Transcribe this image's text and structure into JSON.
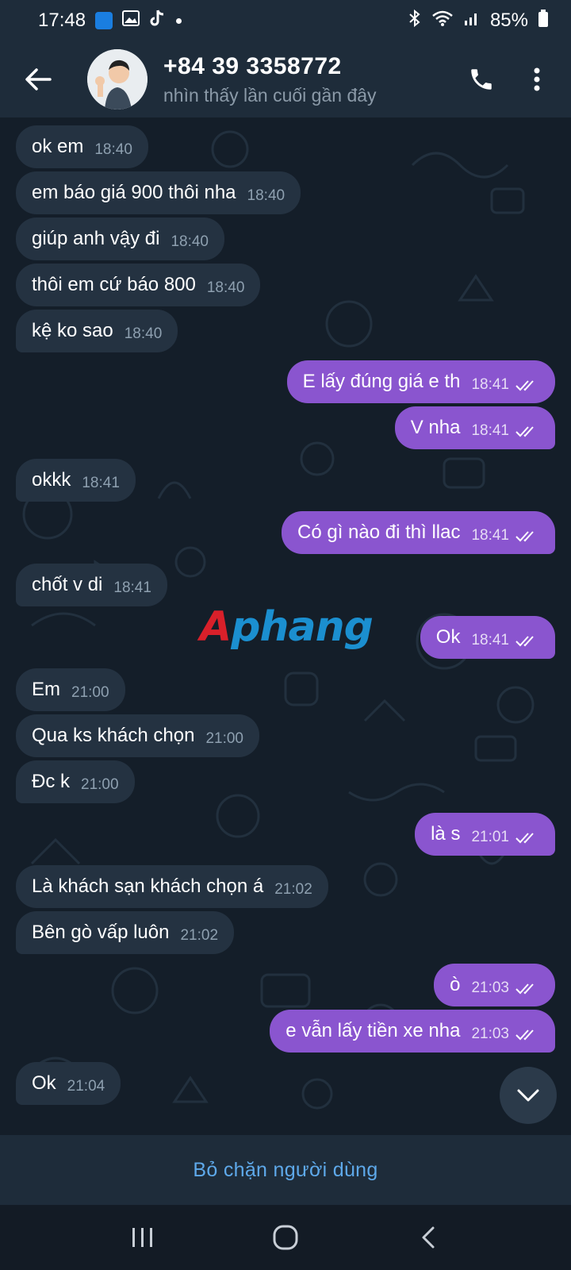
{
  "status_bar": {
    "time": "17:48",
    "battery": "85%",
    "icons": [
      "hotspot-icon",
      "gallery-icon",
      "tiktok-icon",
      "dot-icon",
      "bluetooth-icon",
      "wifi-icon",
      "signal-icon",
      "battery-icon"
    ]
  },
  "header": {
    "title": "+84 39 3358772",
    "subtitle": "nhìn thấy lần cuối gần đây",
    "icons": [
      "back-arrow-icon",
      "phone-icon",
      "more-vertical-icon"
    ]
  },
  "watermark": {
    "part_a": "A",
    "part_b": "phang"
  },
  "messages": [
    {
      "dir": "in",
      "text": "ok em",
      "time": "18:40"
    },
    {
      "dir": "in",
      "text": "em báo giá 900 thôi nha",
      "time": "18:40"
    },
    {
      "dir": "in",
      "text": "giúp anh vậy đi",
      "time": "18:40"
    },
    {
      "dir": "in",
      "text": "thôi em cứ báo 800",
      "time": "18:40"
    },
    {
      "dir": "in",
      "text": "kệ ko sao",
      "time": "18:40"
    },
    {
      "dir": "out",
      "text": "E lấy đúng giá e th",
      "time": "18:41"
    },
    {
      "dir": "out",
      "text": "V nha",
      "time": "18:41"
    },
    {
      "dir": "in",
      "text": "okkk",
      "time": "18:41"
    },
    {
      "dir": "out",
      "text": "Có gì nào đi thì llac",
      "time": "18:41"
    },
    {
      "dir": "in",
      "text": "chốt v di",
      "time": "18:41"
    },
    {
      "dir": "out",
      "text": "Ok",
      "time": "18:41"
    },
    {
      "dir": "in",
      "text": "Em",
      "time": "21:00"
    },
    {
      "dir": "in",
      "text": "Qua ks khách chọn",
      "time": "21:00"
    },
    {
      "dir": "in",
      "text": "Đc k",
      "time": "21:00"
    },
    {
      "dir": "out",
      "text": "là s",
      "time": "21:01"
    },
    {
      "dir": "in",
      "text": "Là khách sạn khách chọn á",
      "time": "21:02"
    },
    {
      "dir": "in",
      "text": "Bên gò vấp luôn",
      "time": "21:02"
    },
    {
      "dir": "out",
      "text": "ò",
      "time": "21:03"
    },
    {
      "dir": "out",
      "text": "e vẫn lấy tiền xe nha",
      "time": "21:03"
    },
    {
      "dir": "in",
      "text": "Ok",
      "time": "21:04"
    }
  ],
  "bottom_action": {
    "label": "Bỏ chặn người dùng"
  },
  "colors": {
    "incoming_bubble": "#243241",
    "outgoing_bubble": "#8a55cf",
    "header": "#1e2c3a",
    "chat_bg": "#141e29",
    "link": "#5ea9ea"
  },
  "nav_bar": {
    "icons": [
      "recent-apps-icon",
      "home-icon",
      "back-icon"
    ]
  }
}
